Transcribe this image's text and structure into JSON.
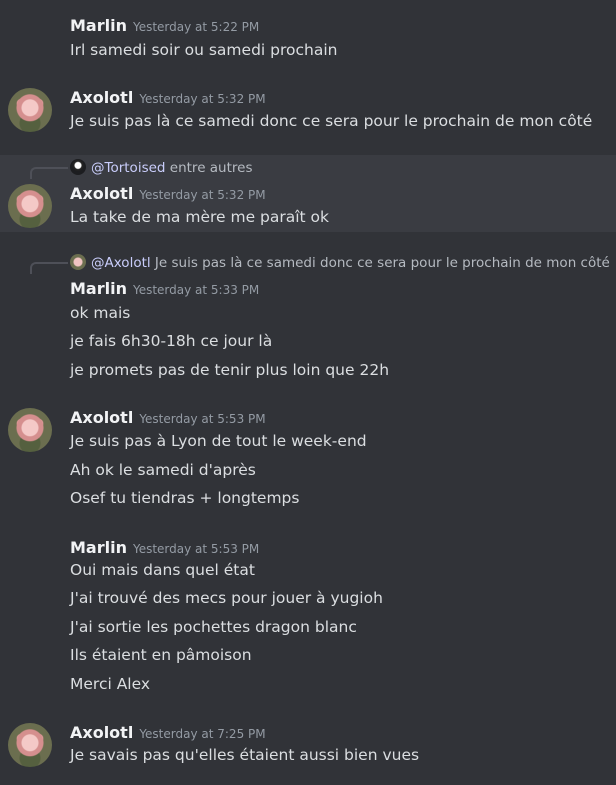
{
  "messages": [
    {
      "author": "Marlin",
      "timestamp": "Yesterday at 5:22 PM",
      "lines": [
        "Irl samedi soir ou samedi prochain"
      ]
    },
    {
      "author": "Axolotl",
      "timestamp": "Yesterday at 5:32 PM",
      "lines": [
        "Je suis pas là ce samedi donc ce sera pour le prochain de mon côté"
      ]
    },
    {
      "reply": {
        "mention": "@Tortoised",
        "text": "entre autres"
      },
      "author": "Axolotl",
      "timestamp": "Yesterday at 5:32 PM",
      "lines": [
        "La take de ma mère me paraît ok"
      ]
    },
    {
      "reply": {
        "mention": "@Axolotl",
        "text": "Je suis pas là ce samedi donc ce sera pour le prochain de mon côté"
      },
      "author": "Marlin",
      "timestamp": "Yesterday at 5:33 PM",
      "lines": [
        "ok mais",
        "je fais 6h30-18h ce jour là",
        "je promets pas de tenir plus loin que 22h"
      ]
    },
    {
      "author": "Axolotl",
      "timestamp": "Yesterday at 5:53 PM",
      "lines": [
        "Je suis pas à Lyon de tout le week-end",
        "Ah ok le samedi d'après",
        "Osef tu tiendras + longtemps"
      ]
    },
    {
      "author": "Marlin",
      "timestamp": "Yesterday at 5:53 PM",
      "lines": [
        "Oui mais dans quel état",
        "J'ai trouvé des mecs pour jouer à yugioh",
        "J'ai sortie les pochettes dragon blanc",
        "Ils étaient en pâmoison",
        "Merci Alex"
      ]
    },
    {
      "author": "Axolotl",
      "timestamp": "Yesterday at 7:25 PM",
      "lines": [
        "Je savais pas qu'elles étaient aussi bien vues"
      ]
    }
  ],
  "icons": {
    "avatar": "axolotl-avatar-icon"
  }
}
